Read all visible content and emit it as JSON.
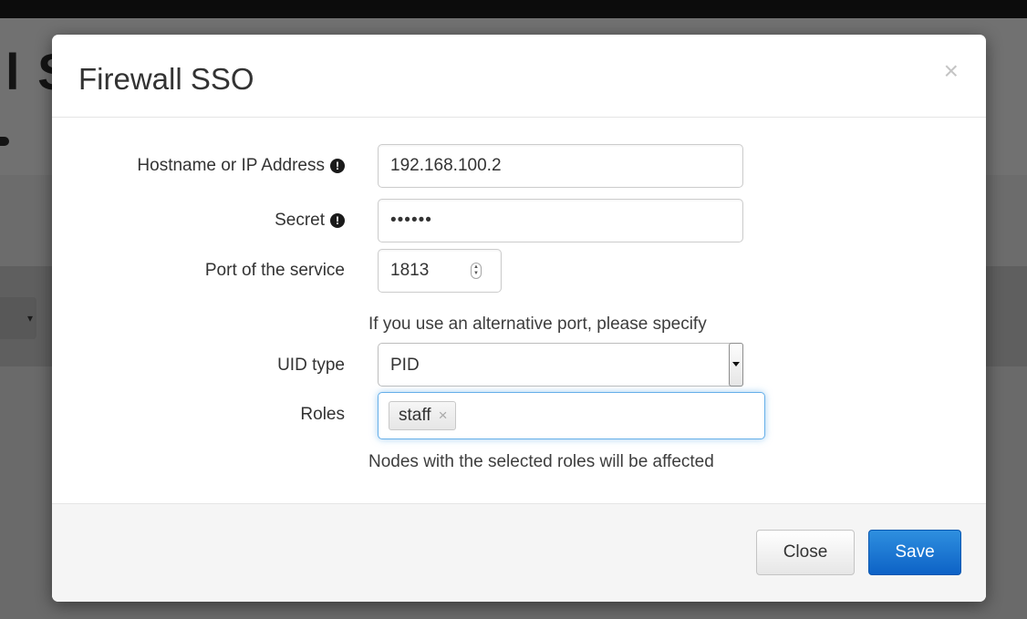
{
  "background": {
    "heading_fragment": "l S"
  },
  "modal": {
    "title": "Firewall SSO",
    "close_symbol": "×",
    "fields": {
      "hostname": {
        "label": "Hostname or IP Address",
        "value": "192.168.100.2",
        "icon": "exclamation-circle-icon"
      },
      "secret": {
        "label": "Secret",
        "value": "••••••",
        "icon": "exclamation-circle-icon"
      },
      "port": {
        "label": "Port of the service",
        "value": "1813",
        "help": "If you use an alternative port, please specify"
      },
      "uid_type": {
        "label": "UID type",
        "selected": "PID"
      },
      "roles": {
        "label": "Roles",
        "tags": [
          "staff"
        ],
        "tag_remove_symbol": "×",
        "help": "Nodes with the selected roles will be affected"
      }
    },
    "footer": {
      "close_label": "Close",
      "save_label": "Save"
    }
  },
  "colors": {
    "primary": "#0d62c6",
    "focus_border": "#66afe9",
    "backdrop": "#6b6b6b"
  }
}
